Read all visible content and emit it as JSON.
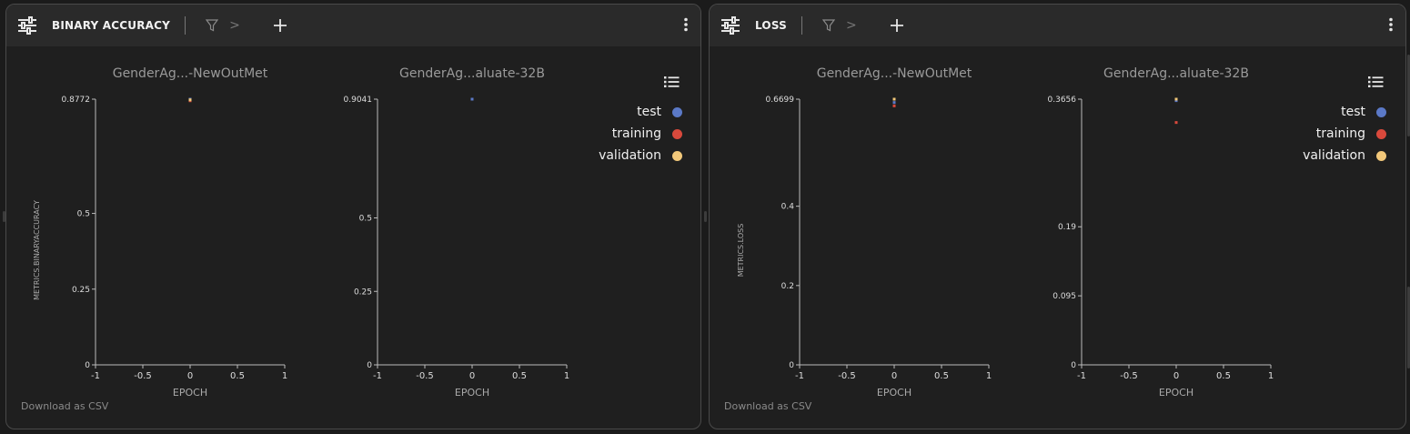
{
  "colors": {
    "test": "#5b79c7",
    "training": "#d9493c",
    "validation": "#f2c87a",
    "axis": "#bbbbbb",
    "text": "#a9a9a9"
  },
  "icons": {
    "settings": "sliders-icon",
    "filter": "filter-icon",
    "add": "plus-icon",
    "menu": "kebab-menu-icon",
    "legend": "list-icon"
  },
  "panels": [
    {
      "title": "BINARY ACCURACY",
      "breadcrumb_separator": ">",
      "download_label": "Download as CSV",
      "legend": [
        {
          "label": "test",
          "color": "#5b79c7"
        },
        {
          "label": "training",
          "color": "#d9493c"
        },
        {
          "label": "validation",
          "color": "#f2c87a"
        }
      ]
    },
    {
      "title": "LOSS",
      "breadcrumb_separator": ">",
      "download_label": "Download as CSV",
      "legend": [
        {
          "label": "test",
          "color": "#5b79c7"
        },
        {
          "label": "training",
          "color": "#d9493c"
        },
        {
          "label": "validation",
          "color": "#f2c87a"
        }
      ]
    }
  ],
  "chart_data": [
    {
      "type": "scatter",
      "title": "GenderAg...-NewOutMet",
      "xlabel": "EPOCH",
      "ylabel": "METRICS.BINARYACCURACY",
      "xlim": [
        -1,
        1
      ],
      "ylim": [
        0,
        0.8772
      ],
      "xticks": [
        "-1",
        "-0.5",
        "0",
        "0.5",
        "1"
      ],
      "yticks": [
        {
          "v": 0,
          "label": "0"
        },
        {
          "v": 0.25,
          "label": "0.25"
        },
        {
          "v": 0.5,
          "label": "0.5"
        },
        {
          "v": 0.8772,
          "label": "0.8772"
        }
      ],
      "series": [
        {
          "name": "test",
          "color": "#5b79c7",
          "points": [
            [
              0,
              0.8772
            ]
          ]
        },
        {
          "name": "training",
          "color": "#d9493c",
          "points": [
            [
              0,
              0.872
            ]
          ]
        },
        {
          "name": "validation",
          "color": "#f2c87a",
          "points": [
            [
              0,
              0.875
            ]
          ]
        }
      ]
    },
    {
      "type": "scatter",
      "title": "GenderAg...aluate-32B",
      "xlabel": "EPOCH",
      "ylabel": "",
      "xlim": [
        -1,
        1
      ],
      "ylim": [
        0,
        0.9041
      ],
      "xticks": [
        "-1",
        "-0.5",
        "0",
        "0.5",
        "1"
      ],
      "yticks": [
        {
          "v": 0,
          "label": "0"
        },
        {
          "v": 0.25,
          "label": "0.25"
        },
        {
          "v": 0.5,
          "label": "0.5"
        },
        {
          "v": 0.9041,
          "label": "0.9041"
        }
      ],
      "series": [
        {
          "name": "test",
          "color": "#5b79c7",
          "points": [
            [
              0,
              0.9041
            ]
          ]
        }
      ]
    },
    {
      "type": "scatter",
      "title": "GenderAg...-NewOutMet",
      "xlabel": "EPOCH",
      "ylabel": "METRICS.LOSS",
      "xlim": [
        -1,
        1
      ],
      "ylim": [
        0,
        0.6699
      ],
      "xticks": [
        "-1",
        "-0.5",
        "0",
        "0.5",
        "1"
      ],
      "yticks": [
        {
          "v": 0,
          "label": "0"
        },
        {
          "v": 0.2,
          "label": "0.2"
        },
        {
          "v": 0.4,
          "label": "0.4"
        },
        {
          "v": 0.6699,
          "label": "0.6699"
        }
      ],
      "series": [
        {
          "name": "test",
          "color": "#5b79c7",
          "points": [
            [
              0,
              0.6615
            ]
          ]
        },
        {
          "name": "training",
          "color": "#d9493c",
          "points": [
            [
              0,
              0.653
            ]
          ]
        },
        {
          "name": "validation",
          "color": "#f2c87a",
          "points": [
            [
              0,
              0.6699
            ]
          ]
        }
      ]
    },
    {
      "type": "scatter",
      "title": "GenderAg...aluate-32B",
      "xlabel": "EPOCH",
      "ylabel": "",
      "xlim": [
        -1,
        1
      ],
      "ylim": [
        0,
        0.3656
      ],
      "xticks": [
        "-1",
        "-0.5",
        "0",
        "0.5",
        "1"
      ],
      "yticks": [
        {
          "v": 0,
          "label": "0"
        },
        {
          "v": 0.095,
          "label": "0.095"
        },
        {
          "v": 0.19,
          "label": "0.19"
        },
        {
          "v": 0.3656,
          "label": "0.3656"
        }
      ],
      "series": [
        {
          "name": "test",
          "color": "#5b79c7",
          "points": [
            [
              0,
              0.3636
            ]
          ]
        },
        {
          "name": "training",
          "color": "#d9493c",
          "points": [
            [
              0,
              0.3335
            ]
          ]
        },
        {
          "name": "validation",
          "color": "#f2c87a",
          "points": [
            [
              0,
              0.3656
            ]
          ]
        }
      ]
    }
  ]
}
